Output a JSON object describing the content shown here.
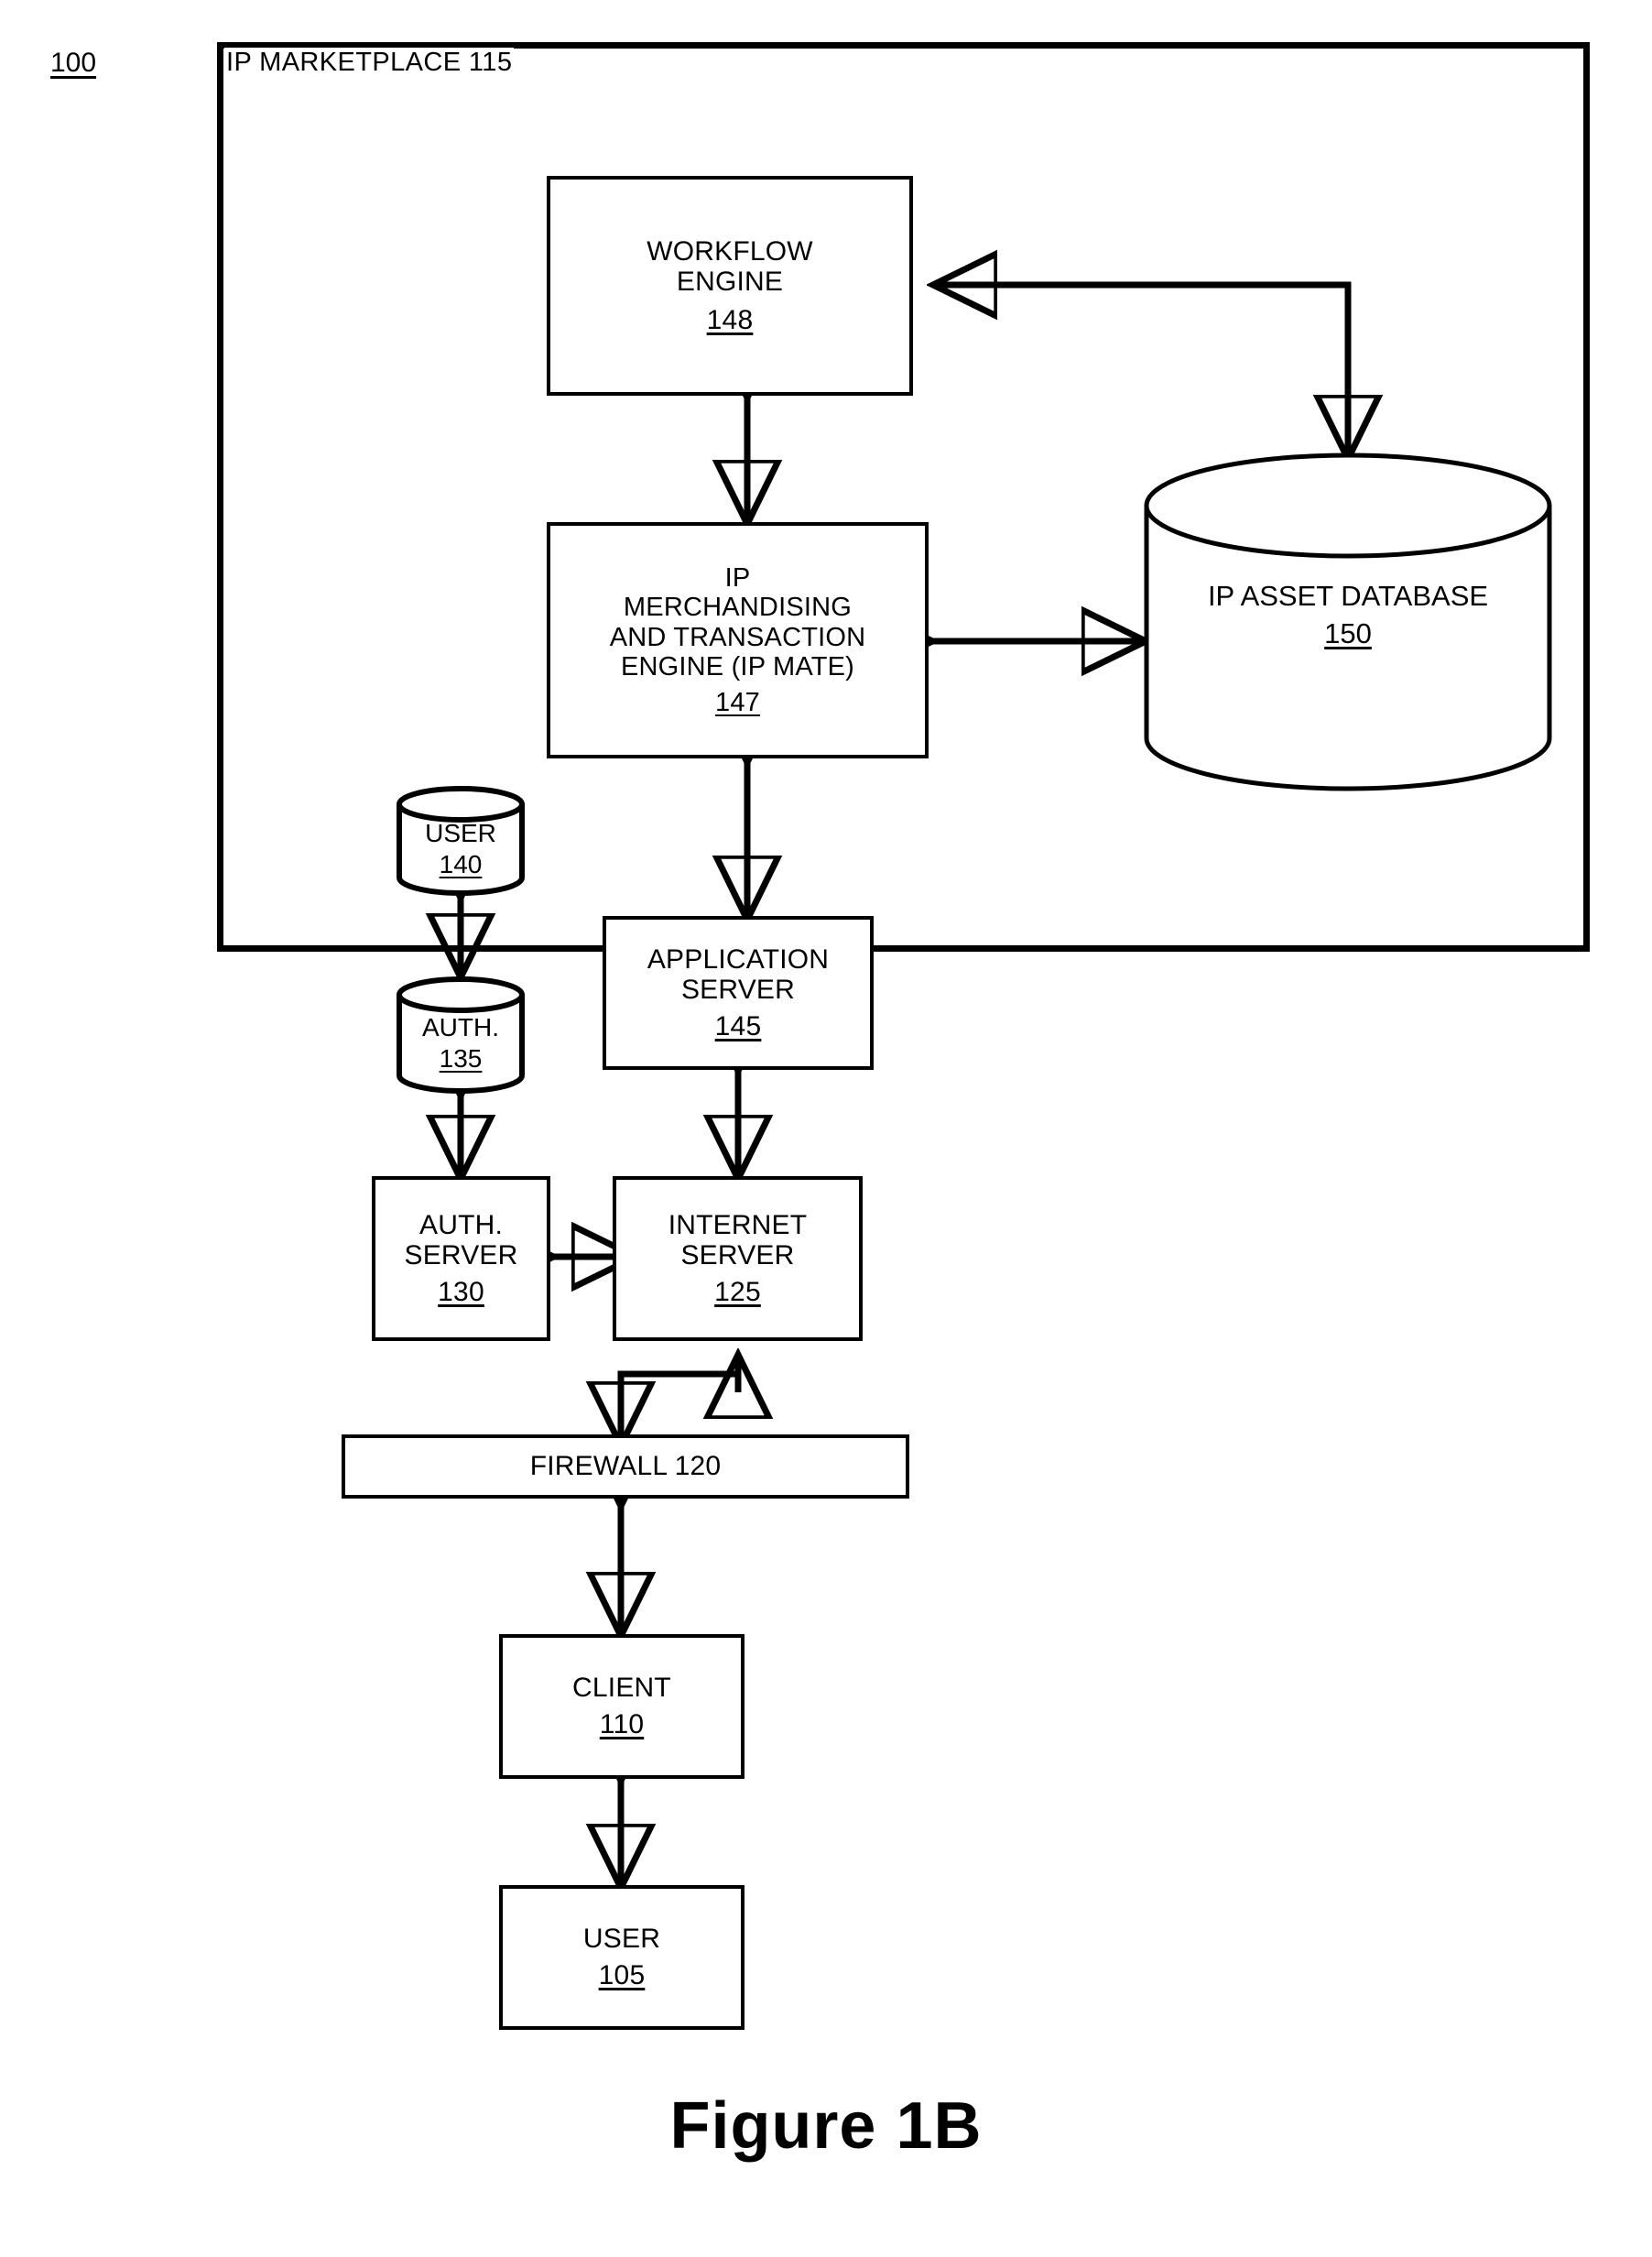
{
  "figure": {
    "ref_label": "100",
    "caption": "Figure 1B"
  },
  "container": {
    "name": "IP MARKETPLACE",
    "ref": "115",
    "label": "IP MARKETPLACE 115"
  },
  "nodes": {
    "workflow_engine": {
      "title": "WORKFLOW\nENGINE",
      "ref": "148",
      "shape": "rectangle"
    },
    "ip_mate": {
      "title": "IP\nMERCHANDISING\nAND TRANSACTION\nENGINE (IP MATE)",
      "ref": "147",
      "shape": "rectangle"
    },
    "ip_asset_database": {
      "title": "IP ASSET DATABASE",
      "ref": "150",
      "shape": "cylinder"
    },
    "user_db": {
      "title": "USER",
      "ref": "140",
      "shape": "cylinder"
    },
    "auth_db": {
      "title": "AUTH.",
      "ref": "135",
      "shape": "cylinder"
    },
    "application_server": {
      "title": "APPLICATION\nSERVER",
      "ref": "145",
      "shape": "rectangle"
    },
    "auth_server": {
      "title": "AUTH.\nSERVER",
      "ref": "130",
      "shape": "rectangle"
    },
    "internet_server": {
      "title": "INTERNET\nSERVER",
      "ref": "125",
      "shape": "rectangle"
    },
    "firewall": {
      "title": "FIREWALL",
      "ref": "120",
      "label": "FIREWALL 120",
      "shape": "rectangle"
    },
    "client": {
      "title": "CLIENT",
      "ref": "110",
      "shape": "rectangle"
    },
    "user": {
      "title": "USER",
      "ref": "105",
      "shape": "rectangle"
    }
  },
  "connections": [
    {
      "from": "ip_asset_database",
      "to": "workflow_engine",
      "style": "elbow",
      "arrows": "single"
    },
    {
      "from": "workflow_engine",
      "to": "ip_mate",
      "style": "straight",
      "arrows": "double"
    },
    {
      "from": "ip_mate",
      "to": "ip_asset_database",
      "style": "straight",
      "arrows": "double"
    },
    {
      "from": "ip_mate",
      "to": "application_server",
      "style": "straight",
      "arrows": "double"
    },
    {
      "from": "user_db",
      "to": "auth_db",
      "style": "straight",
      "arrows": "double"
    },
    {
      "from": "auth_db",
      "to": "auth_server",
      "style": "straight",
      "arrows": "double"
    },
    {
      "from": "application_server",
      "to": "internet_server",
      "style": "straight",
      "arrows": "double"
    },
    {
      "from": "auth_server",
      "to": "internet_server",
      "style": "straight",
      "arrows": "double"
    },
    {
      "from": "internet_server",
      "to": "firewall",
      "style": "elbow",
      "arrows": "single"
    },
    {
      "from": "firewall",
      "to": "client",
      "style": "straight",
      "arrows": "double"
    },
    {
      "from": "client",
      "to": "user",
      "style": "straight",
      "arrows": "double"
    }
  ],
  "colors": {
    "ink": "#000000",
    "paper": "#ffffff"
  }
}
